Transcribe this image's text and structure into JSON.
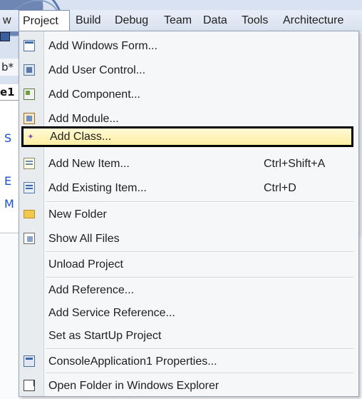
{
  "menubar": {
    "items": [
      "w",
      "Project",
      "Build",
      "Debug",
      "Team",
      "Data",
      "Tools",
      "Architecture"
    ],
    "active": "Project"
  },
  "background": {
    "tab_text": "b*",
    "tab_bold": "e1",
    "link_s": "S",
    "link_e": "E",
    "link_m": "M"
  },
  "menu": {
    "items": [
      {
        "label": "Add Windows Form...",
        "icon": "windows-form-icon"
      },
      {
        "label": "Add User Control...",
        "icon": "user-control-icon"
      },
      {
        "label": "Add Component...",
        "icon": "component-icon"
      },
      {
        "label": "Add Module...",
        "icon": "module-icon"
      },
      {
        "label": "Add Class...",
        "icon": "class-icon",
        "highlighted": true
      },
      {
        "label": "Add New Item...",
        "shortcut": "Ctrl+Shift+A",
        "icon": "new-item-icon"
      },
      {
        "label": "Add Existing Item...",
        "shortcut": "Ctrl+D",
        "icon": "existing-item-icon"
      },
      {
        "label": "New Folder",
        "icon": "folder-icon"
      },
      {
        "label": "Show All Files",
        "icon": "show-all-files-icon"
      },
      {
        "label": "Unload Project"
      },
      {
        "label": "Add Reference..."
      },
      {
        "label": "Add Service Reference..."
      },
      {
        "label": "Set as StartUp Project"
      },
      {
        "label": "ConsoleApplication1 Properties...",
        "icon": "properties-icon"
      },
      {
        "label": "Open Folder in Windows Explorer",
        "icon": "open-folder-icon"
      }
    ]
  },
  "colors": {
    "highlight_fill": "#ffeea1",
    "highlight_border": "#000000",
    "menu_background": "#f6f7f8",
    "link_blue": "#1a4fd0"
  }
}
